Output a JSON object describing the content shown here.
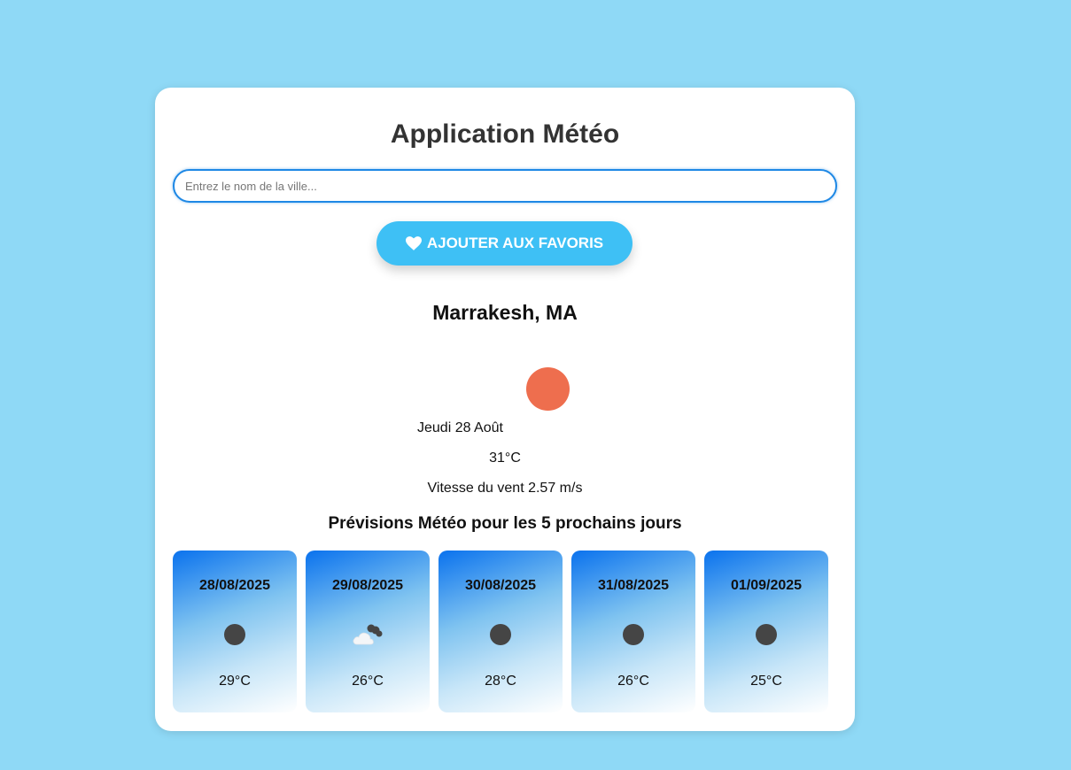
{
  "app": {
    "title": "Application Météo"
  },
  "search": {
    "placeholder": "Entrez le nom de la ville...",
    "value": ""
  },
  "favorites_button": {
    "label": "AJOUTER AUX FAVORIS",
    "icon": "heart-icon"
  },
  "current": {
    "city": "Marrakesh, MA",
    "icon": "sun-icon",
    "date": "Jeudi 28 Août",
    "temperature": "31°C",
    "wind": "Vitesse du vent 2.57 m/s"
  },
  "forecast": {
    "title": "Prévisions Météo pour les 5 prochains jours",
    "days": [
      {
        "date": "28/08/2025",
        "icon": "dot-icon",
        "temp": "29°C"
      },
      {
        "date": "29/08/2025",
        "icon": "cloud-icon",
        "temp": "26°C"
      },
      {
        "date": "30/08/2025",
        "icon": "dot-icon",
        "temp": "28°C"
      },
      {
        "date": "31/08/2025",
        "icon": "dot-icon",
        "temp": "26°C"
      },
      {
        "date": "01/09/2025",
        "icon": "dot-icon",
        "temp": "25°C"
      }
    ]
  },
  "colors": {
    "background": "#8fd9f6",
    "accent": "#3ec0f5",
    "input_border": "#1e88e5",
    "sun": "#ee6e4e"
  }
}
